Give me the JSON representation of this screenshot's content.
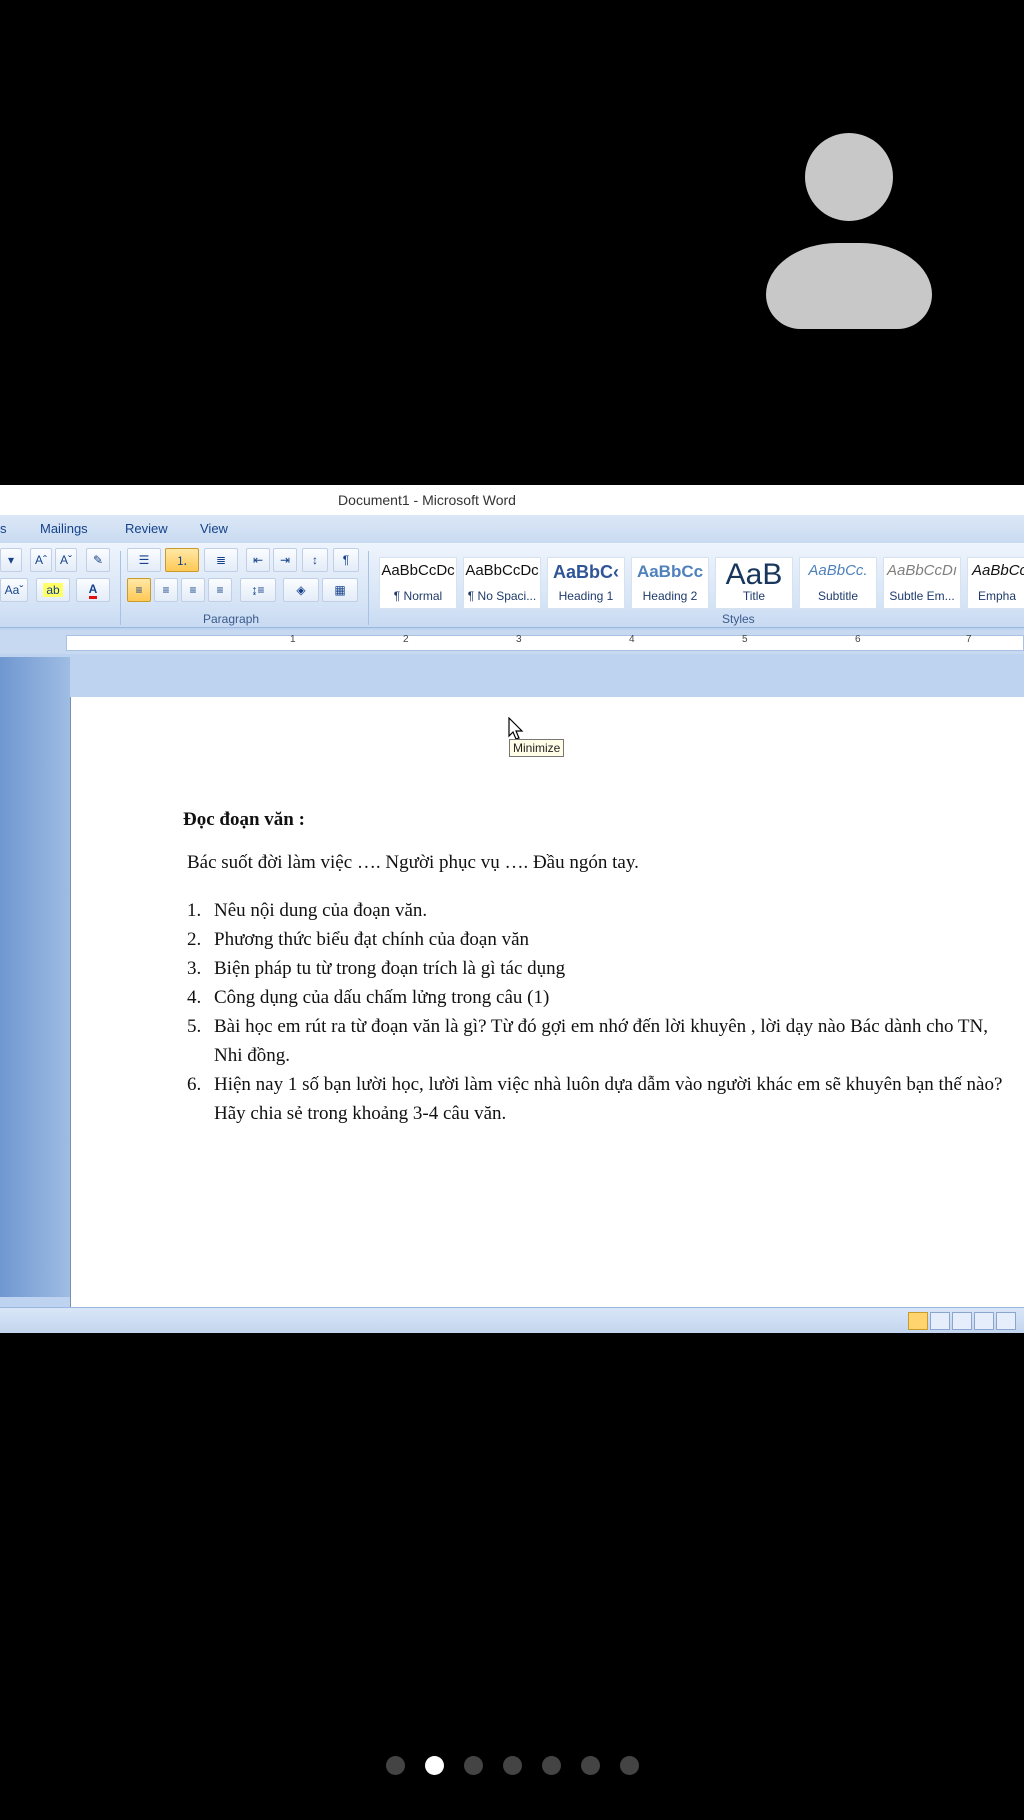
{
  "window_title": "Document1 - Microsoft Word",
  "tabs": [
    "s",
    "Mailings",
    "Review",
    "View"
  ],
  "ribbon": {
    "paragraph_label": "Paragraph",
    "styles_label": "Styles",
    "font_buttons": [
      "Aˆ",
      "Aˇ",
      "Aaˇ"
    ],
    "styles": [
      {
        "sample": "AaBbCcDc",
        "name": "¶ Normal",
        "color": "#111111"
      },
      {
        "sample": "AaBbCcDc",
        "name": "¶ No Spaci...",
        "color": "#111111"
      },
      {
        "sample": "AaBbC‹",
        "name": "Heading 1",
        "color": "#2f5597"
      },
      {
        "sample": "AaBbCc",
        "name": "Heading 2",
        "color": "#4f81bd"
      },
      {
        "sample": "AaB",
        "name": "Title",
        "color": "#17365d"
      },
      {
        "sample": "AaBbCc.",
        "name": "Subtitle",
        "color": "#4f81bd"
      },
      {
        "sample": "AaBbCcDı",
        "name": "Subtle Em...",
        "color": "#7f7f7f"
      },
      {
        "sample": "AaBbCc",
        "name": "Empha",
        "color": "#111111"
      }
    ]
  },
  "ruler_numbers": [
    "1",
    "2",
    "3",
    "4",
    "5",
    "6",
    "7"
  ],
  "document": {
    "heading": "Đọc đoạn văn :",
    "intro": "Bác suốt đời làm việc …. Người phục vụ …. Đầu ngón tay.",
    "items": [
      {
        "n": "1.",
        "text": "Nêu nội dung của đoạn văn."
      },
      {
        "n": "2.",
        "text": "Phương thức biểu đạt chính của đoạn văn"
      },
      {
        "n": "3.",
        "text": "Biện pháp tu từ trong đoạn trích là gì tác dụng"
      },
      {
        "n": "4.",
        "text": "Công dụng của dấu chấm lửng trong câu (1)"
      },
      {
        "n": "5.",
        "text": "Bài học em rút ra từ đoạn văn là gì? Từ đó gợi em nhớ đến lời khuyên , lời dạy nào Bác dành cho TN, Nhi đồng."
      },
      {
        "n": "6.",
        "text": "Hiện nay 1 số bạn lười học, lười làm việc nhà luôn dựa dẫm vào người khác em sẽ khuyên bạn thế nào? Hãy chia sẻ trong khoảng 3-4 câu văn."
      }
    ]
  },
  "tooltip": "Minimize",
  "pager": {
    "count": 7,
    "active": 2
  }
}
